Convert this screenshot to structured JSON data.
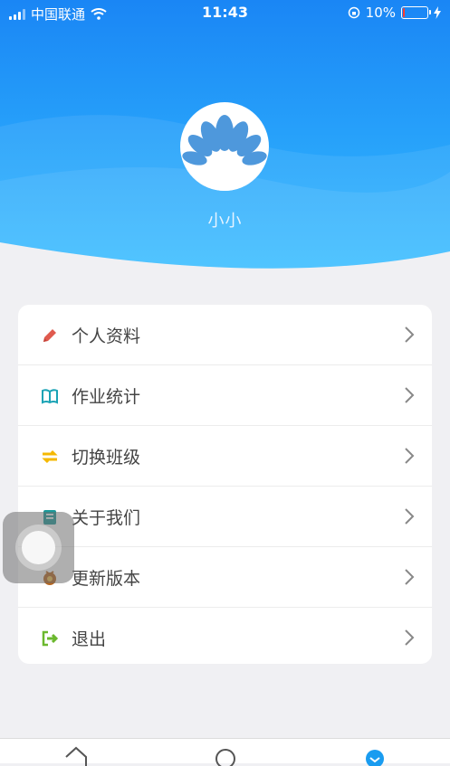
{
  "status_bar": {
    "carrier": "中国联通",
    "time": "11:43",
    "battery_percent": "10%",
    "battery_level": 0.1
  },
  "profile": {
    "username": "小小"
  },
  "menu": {
    "items": [
      {
        "label": "个人资料",
        "icon": "pencil-icon",
        "color": "#e05a4e"
      },
      {
        "label": "作业统计",
        "icon": "book-icon",
        "color": "#1aa3b5"
      },
      {
        "label": "切换班级",
        "icon": "swap-arrows-icon",
        "color": "#f5b800"
      },
      {
        "label": "关于我们",
        "icon": "info-card-icon",
        "color": "#1a9a9a"
      },
      {
        "label": "更新版本",
        "icon": "update-icon",
        "color": "#b5651d"
      },
      {
        "label": "退出",
        "icon": "logout-icon",
        "color": "#6bb82e"
      }
    ]
  },
  "colors": {
    "header_top": "#1a86f5",
    "header_bottom": "#33b8ff",
    "background": "#f0f0f3",
    "active_tab": "#1a9cf0"
  },
  "tabbar": {
    "tabs": [
      {
        "icon": "home-icon"
      },
      {
        "icon": "message-icon"
      },
      {
        "icon": "profile-icon",
        "active": true
      }
    ]
  }
}
